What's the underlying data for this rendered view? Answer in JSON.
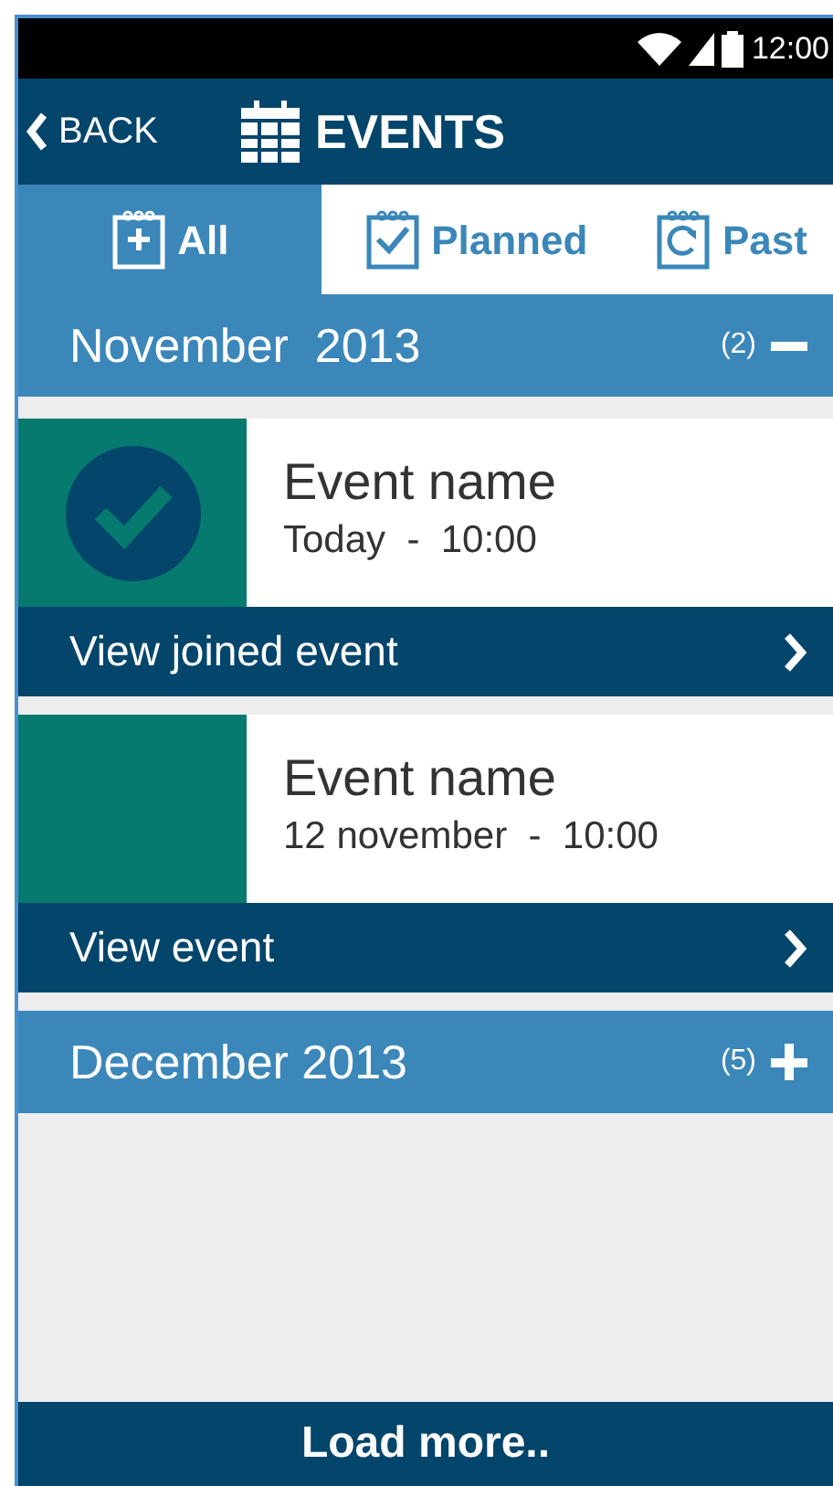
{
  "status_bar": {
    "time": "12:00"
  },
  "app_bar": {
    "back": "BACK",
    "title": "EVENTS"
  },
  "tabs": [
    {
      "label": "All",
      "kind": "all",
      "selected": true
    },
    {
      "label": "Planned",
      "kind": "planned",
      "selected": false
    },
    {
      "label": "Past",
      "kind": "past",
      "selected": false
    }
  ],
  "sections": [
    {
      "title": "November  2013",
      "count": "(2)",
      "expanded": true,
      "events": [
        {
          "name": "Event name",
          "when": "Today  -  10:00",
          "joined": true,
          "action": "View joined event"
        },
        {
          "name": "Event name",
          "when": "12 november  -  10:00",
          "joined": false,
          "action": "View event"
        }
      ]
    },
    {
      "title": "December 2013",
      "count": "(5)",
      "expanded": false
    }
  ],
  "load_more": "Load more.."
}
